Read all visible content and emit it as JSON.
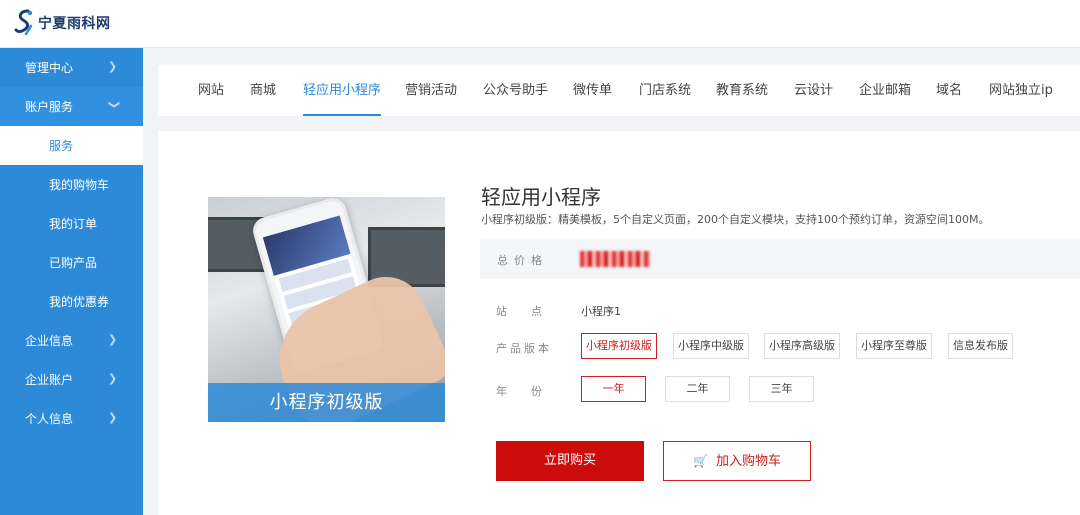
{
  "header": {
    "site_name": "宁夏雨科网",
    "logo_icon": "ys-logo-icon"
  },
  "sidebar": {
    "items": [
      {
        "label": "管理中心"
      },
      {
        "label": "账户服务"
      },
      {
        "label": "服务"
      },
      {
        "label": "我的购物车"
      },
      {
        "label": "我的订单"
      },
      {
        "label": "已购产品"
      },
      {
        "label": "我的优惠券"
      },
      {
        "label": "企业信息"
      },
      {
        "label": "企业账户"
      },
      {
        "label": "个人信息"
      }
    ]
  },
  "tabs": [
    {
      "label": "网站"
    },
    {
      "label": "商城"
    },
    {
      "label": "轻应用小程序"
    },
    {
      "label": "营销活动"
    },
    {
      "label": "公众号助手"
    },
    {
      "label": "微传单"
    },
    {
      "label": "门店系统"
    },
    {
      "label": "教育系统"
    },
    {
      "label": "云设计"
    },
    {
      "label": "企业邮箱"
    },
    {
      "label": "域名"
    },
    {
      "label": "网站独立ip"
    }
  ],
  "product": {
    "image_caption": "小程序初级版",
    "title": "轻应用小程序",
    "description": "小程序初级版：精美模板，5个自定义页面，200个自定义模块，支持100个预约订单，资源空间100M。",
    "price_label": "总价格",
    "site_label": "站点",
    "site_value": "小程序1",
    "version_label": "产品版本",
    "versions": [
      "小程序初级版",
      "小程序中级版",
      "小程序高级版",
      "小程序至尊版",
      "信息发布版"
    ],
    "year_label": "年份",
    "years": [
      "一年",
      "二年",
      "三年"
    ],
    "buy_label": "立即购买",
    "cart_label": "加入购物车"
  },
  "colors": {
    "accent": "#2d8ad8",
    "buy": "#cc0b0b"
  }
}
